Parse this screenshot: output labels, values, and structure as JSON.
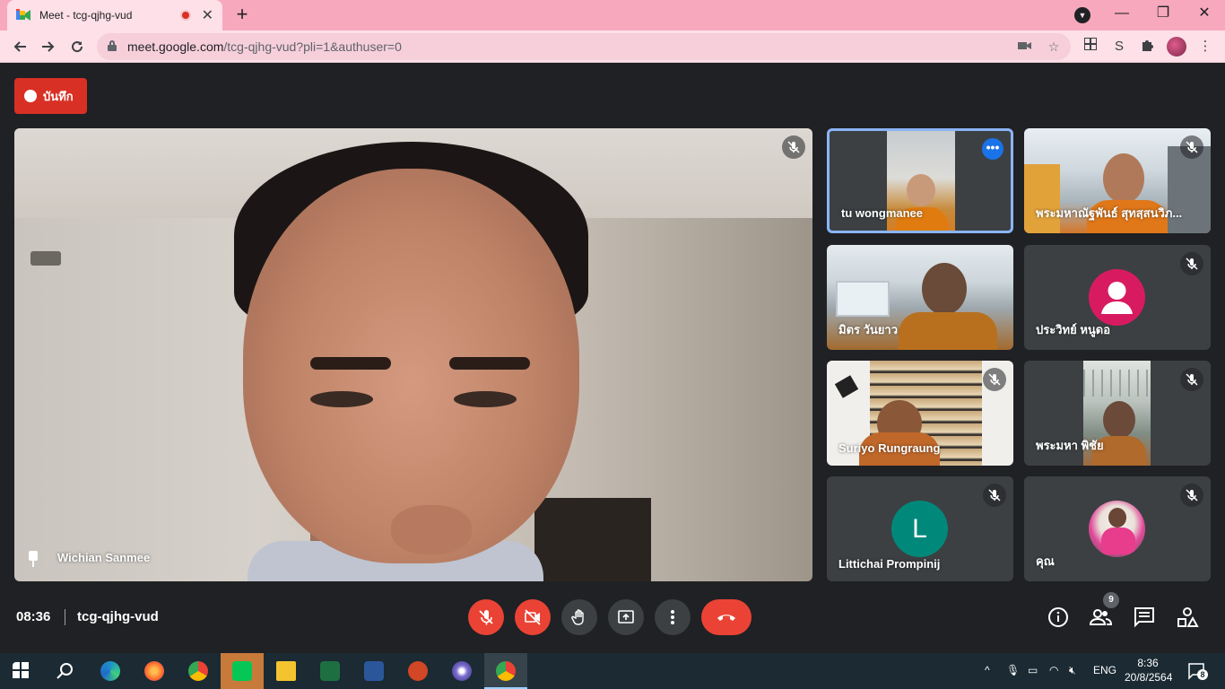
{
  "browser": {
    "tab_title": "Meet - tcg-qjhg-vud",
    "tab_close": "✕",
    "new_tab": "+",
    "url_host": "meet.google.com",
    "url_path": "/tcg-qjhg-vud?pli=1&authuser=0",
    "window_controls": {
      "minimize": "—",
      "restore": "❐",
      "close": "✕"
    }
  },
  "meet": {
    "recording_label": "บันทึก",
    "main_speaker": "Wichian Sanmee",
    "participants": [
      {
        "name": "tu wongmanee",
        "type": "video",
        "muted": false,
        "active": true
      },
      {
        "name": "พระมหาณัฐพันธ์ สุทสฺสนวิภ...",
        "type": "video",
        "muted": true,
        "active": false
      },
      {
        "name": "มิตร วันยาว",
        "type": "video",
        "muted": false,
        "active": false
      },
      {
        "name": "ประวิทย์ หนูดอ",
        "type": "avatar",
        "muted": true,
        "active": false
      },
      {
        "name": "Suriyo Rungraung",
        "type": "video",
        "muted": true,
        "active": false
      },
      {
        "name": "พระมหา พิชัย",
        "type": "video",
        "muted": true,
        "active": false
      },
      {
        "name": "Littichai Prompinij",
        "type": "letter",
        "letter": "L",
        "muted": true,
        "active": false
      },
      {
        "name": "คุณ",
        "type": "photo",
        "muted": true,
        "active": false
      }
    ],
    "clock": "08:36",
    "meeting_code": "tcg-qjhg-vud",
    "participant_count": "9",
    "colors": {
      "record_red": "#d93025",
      "control_red": "#ea4335",
      "active_border": "#8ab4f8",
      "avatar_pink": "#d81b60",
      "avatar_teal": "#00897b"
    }
  },
  "taskbar": {
    "language": "ENG",
    "time": "8:36",
    "date": "20/8/2564",
    "notification_count": "8",
    "apps": [
      "windows-start",
      "search",
      "edge",
      "firefox",
      "chrome",
      "line",
      "file-explorer",
      "excel",
      "word",
      "powerpoint",
      "app",
      "chrome-meet"
    ]
  }
}
